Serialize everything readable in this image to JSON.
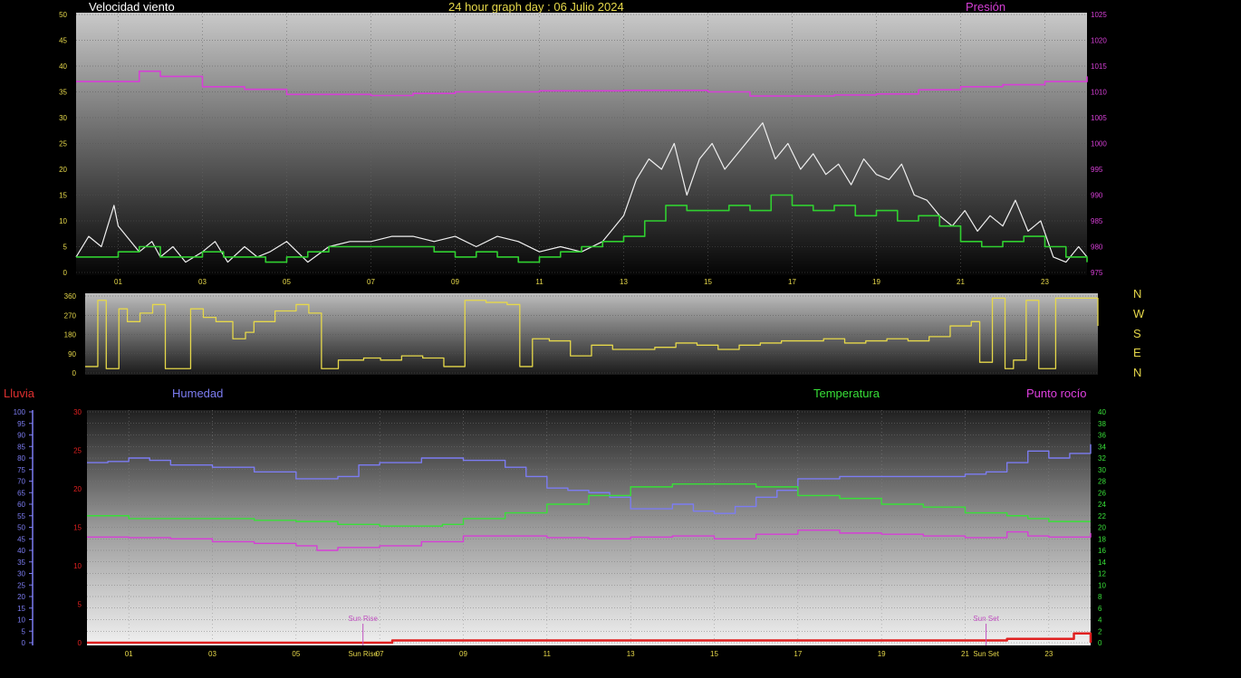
{
  "titles": {
    "main": "24 hour graph day : 06 Julio 2024",
    "wind": "Velocidad viento",
    "pressure": "Presión",
    "rain": "Lluvia",
    "humidity": "Humedad",
    "temperature": "Temperatura",
    "dewpoint": "Punto rocío"
  },
  "directions": [
    "N",
    "W",
    "S",
    "E",
    "N"
  ],
  "colors": {
    "wind_gust": "#f0f0f0",
    "wind_avg": "#30d030",
    "pressure": "#d63fd6",
    "direction": "#e6d84a",
    "humidity": "#7c7cf2",
    "temperature": "#38e038",
    "dewpoint": "#d63fd6",
    "rain": "#e02020",
    "sun": "#c050c0"
  },
  "chart_data": [
    {
      "type": "line",
      "name": "wind-pressure",
      "x_ticks": [
        "01",
        "03",
        "05",
        "07",
        "09",
        "11",
        "13",
        "15",
        "17",
        "19",
        "21",
        "23"
      ],
      "y_left_ticks": [
        "0",
        "5",
        "10",
        "15",
        "20",
        "25",
        "30",
        "35",
        "40",
        "45",
        "50"
      ],
      "y_right_ticks": [
        "975",
        "980",
        "985",
        "990",
        "995",
        "1000",
        "1005",
        "1010",
        "1015",
        "1020",
        "1025"
      ],
      "ylim_left": [
        0,
        50
      ],
      "ylim_right": [
        975,
        1025
      ],
      "xlim": [
        0,
        24
      ],
      "series": [
        {
          "name": "Velocidad viento",
          "axis": "left",
          "kind": "gust",
          "x": [
            0,
            0.3,
            0.6,
            0.9,
            1.0,
            1.2,
            1.5,
            1.8,
            2.0,
            2.3,
            2.6,
            3.0,
            3.3,
            3.6,
            4.0,
            4.3,
            4.6,
            5.0,
            5.5,
            6.0,
            6.5,
            7.0,
            7.5,
            8.0,
            8.5,
            9.0,
            9.5,
            10.0,
            10.5,
            11.0,
            11.5,
            12.0,
            12.5,
            13.0,
            13.3,
            13.6,
            13.9,
            14.2,
            14.5,
            14.8,
            15.1,
            15.4,
            15.7,
            16.0,
            16.3,
            16.6,
            16.9,
            17.2,
            17.5,
            17.8,
            18.1,
            18.4,
            18.7,
            19.0,
            19.3,
            19.6,
            19.9,
            20.2,
            20.5,
            20.8,
            21.1,
            21.4,
            21.7,
            22.0,
            22.3,
            22.6,
            22.9,
            23.2,
            23.5,
            23.8,
            24.0
          ],
          "y": [
            3,
            7,
            5,
            13,
            9,
            7,
            4,
            6,
            3,
            5,
            2,
            4,
            6,
            2,
            5,
            3,
            4,
            6,
            2,
            5,
            6,
            6,
            7,
            7,
            6,
            7,
            5,
            7,
            6,
            4,
            5,
            4,
            6,
            11,
            18,
            22,
            20,
            25,
            15,
            22,
            25,
            20,
            23,
            26,
            29,
            22,
            25,
            20,
            23,
            19,
            21,
            17,
            22,
            19,
            18,
            21,
            15,
            14,
            11,
            9,
            12,
            8,
            11,
            9,
            14,
            8,
            10,
            3,
            2,
            5,
            3
          ]
        },
        {
          "name": "Velocidad viento",
          "axis": "left",
          "kind": "avg",
          "x": [
            0,
            0.5,
            1.0,
            1.5,
            2.0,
            2.5,
            3.0,
            3.5,
            4.0,
            4.5,
            5.0,
            5.5,
            6.0,
            6.5,
            7.0,
            7.5,
            8.0,
            8.5,
            9.0,
            9.5,
            10.0,
            10.5,
            11.0,
            11.5,
            12.0,
            12.5,
            13.0,
            13.5,
            14.0,
            14.5,
            15.0,
            15.5,
            16.0,
            16.5,
            17.0,
            17.5,
            18.0,
            18.5,
            19.0,
            19.5,
            20.0,
            20.5,
            21.0,
            21.5,
            22.0,
            22.5,
            23.0,
            23.5,
            24.0
          ],
          "y": [
            3,
            3,
            4,
            5,
            3,
            3,
            4,
            3,
            3,
            2,
            3,
            4,
            5,
            5,
            5,
            5,
            5,
            4,
            3,
            4,
            3,
            2,
            3,
            4,
            5,
            6,
            7,
            10,
            13,
            12,
            12,
            13,
            12,
            15,
            13,
            12,
            13,
            11,
            12,
            10,
            11,
            9,
            6,
            5,
            6,
            7,
            5,
            3,
            2
          ]
        },
        {
          "name": "Presión",
          "axis": "right",
          "x": [
            0,
            1.0,
            1.5,
            2.0,
            3.0,
            4.0,
            5.0,
            6.0,
            7.0,
            8.0,
            9.0,
            10.0,
            11.0,
            12.0,
            13.0,
            14.0,
            15.0,
            16.0,
            17.0,
            18.0,
            19.0,
            20.0,
            21.0,
            22.0,
            23.0,
            24.0
          ],
          "y": [
            1012,
            1012,
            1014,
            1013,
            1011,
            1010.5,
            1009.5,
            1009.5,
            1009.3,
            1009.7,
            1010,
            1010,
            1010.2,
            1010.2,
            1010.3,
            1010.3,
            1010,
            1009.2,
            1009.2,
            1009.4,
            1009.6,
            1010.4,
            1011,
            1011.4,
            1012,
            1013
          ]
        }
      ]
    },
    {
      "type": "line",
      "name": "wind-direction",
      "y_ticks": [
        "0",
        "90",
        "180",
        "270",
        "360"
      ],
      "ylim": [
        0,
        360
      ],
      "xlim": [
        0,
        24
      ],
      "series": [
        {
          "name": "direction",
          "x": [
            0,
            0.3,
            0.5,
            0.8,
            1.0,
            1.3,
            1.6,
            1.9,
            2.2,
            2.5,
            2.8,
            3.1,
            3.5,
            3.8,
            4.0,
            4.5,
            5.0,
            5.3,
            5.6,
            6.0,
            6.3,
            6.6,
            7.0,
            7.5,
            8.0,
            8.5,
            9.0,
            9.5,
            10.0,
            10.3,
            10.6,
            11.0,
            11.5,
            12.0,
            12.5,
            13.0,
            13.5,
            14.0,
            14.5,
            15.0,
            15.5,
            16.0,
            16.5,
            17.0,
            17.5,
            18.0,
            18.5,
            19.0,
            19.5,
            20.0,
            20.5,
            21.0,
            21.2,
            21.5,
            21.8,
            22.0,
            22.3,
            22.6,
            23.0,
            23.5,
            24.0
          ],
          "y": [
            30,
            340,
            20,
            300,
            240,
            280,
            320,
            20,
            20,
            300,
            260,
            240,
            160,
            190,
            240,
            290,
            320,
            280,
            20,
            60,
            60,
            70,
            60,
            80,
            70,
            30,
            340,
            330,
            320,
            30,
            160,
            150,
            80,
            130,
            110,
            110,
            120,
            140,
            130,
            110,
            130,
            140,
            150,
            150,
            160,
            140,
            150,
            160,
            150,
            170,
            220,
            240,
            50,
            350,
            20,
            60,
            340,
            20,
            350,
            350,
            220
          ]
        }
      ]
    },
    {
      "type": "line",
      "name": "temp-humidity-rain",
      "x_ticks": [
        "01",
        "03",
        "05",
        "07",
        "09",
        "11",
        "13",
        "15",
        "17",
        "19",
        "21",
        "23"
      ],
      "y_rain_ticks": [
        "0",
        "5",
        "10",
        "15",
        "20",
        "25",
        "30"
      ],
      "y_hum_ticks": [
        "0",
        "5",
        "10",
        "15",
        "20",
        "25",
        "30",
        "35",
        "40",
        "45",
        "50",
        "55",
        "60",
        "65",
        "70",
        "75",
        "80",
        "85",
        "90",
        "95",
        "100"
      ],
      "y_temp_ticks": [
        "0",
        "2",
        "4",
        "6",
        "8",
        "10",
        "12",
        "14",
        "16",
        "18",
        "20",
        "22",
        "24",
        "26",
        "28",
        "30",
        "32",
        "34",
        "36",
        "38",
        "40"
      ],
      "ylim_rain": [
        0,
        30
      ],
      "ylim_hum": [
        0,
        100
      ],
      "ylim_temp": [
        0,
        40
      ],
      "xlim": [
        0,
        24
      ],
      "annotations": [
        {
          "text": "Sun Rise",
          "x": 6.6
        },
        {
          "text": "Sun Set",
          "x": 21.5
        }
      ],
      "bottom_labels": [
        "Sun Rise",
        "Sun Set"
      ],
      "series": [
        {
          "name": "Humedad",
          "axis": "hum",
          "x": [
            0,
            0.5,
            1.0,
            1.5,
            2.0,
            3.0,
            4.0,
            5.0,
            5.5,
            6.0,
            6.5,
            7.0,
            8.0,
            9.0,
            9.5,
            10.0,
            10.5,
            11.0,
            11.5,
            12.0,
            12.5,
            13.0,
            13.5,
            14.0,
            14.5,
            15.0,
            15.5,
            16.0,
            16.5,
            17.0,
            18.0,
            19.0,
            20.0,
            21.0,
            21.5,
            22.0,
            22.5,
            23.0,
            23.5,
            24.0
          ],
          "y": [
            78,
            78.5,
            80,
            79,
            77,
            76,
            74,
            71,
            71,
            72,
            77,
            78,
            80,
            79,
            79,
            76,
            72,
            67,
            66,
            65,
            63,
            58,
            58,
            60,
            57,
            56,
            59,
            63,
            66,
            71,
            72,
            72,
            72,
            73,
            74,
            78,
            83,
            80,
            82,
            86
          ]
        },
        {
          "name": "Temperatura",
          "axis": "temp",
          "x": [
            0,
            1.0,
            2.0,
            3.0,
            4.0,
            5.0,
            6.0,
            7.0,
            8.0,
            8.5,
            9.0,
            10.0,
            11.0,
            12.0,
            13.0,
            14.0,
            15.0,
            16.0,
            17.0,
            18.0,
            19.0,
            20.0,
            21.0,
            22.0,
            22.5,
            23.0,
            24.0
          ],
          "y": [
            22,
            21.5,
            21.5,
            21.5,
            21.2,
            21,
            20.5,
            20.2,
            20.2,
            20.5,
            21.5,
            22.5,
            24,
            25.5,
            27,
            27.5,
            27.5,
            27,
            25.5,
            25,
            24,
            23.5,
            22.5,
            22,
            21.5,
            21,
            21
          ]
        },
        {
          "name": "Punto rocío",
          "axis": "temp",
          "x": [
            0,
            1.0,
            2.0,
            3.0,
            4.0,
            5.0,
            5.5,
            6.0,
            7.0,
            8.0,
            9.0,
            10.0,
            11.0,
            12.0,
            13.0,
            14.0,
            15.0,
            16.0,
            17.0,
            18.0,
            19.0,
            20.0,
            21.0,
            22.0,
            22.5,
            23.0,
            24.0
          ],
          "y": [
            18.3,
            18.2,
            18,
            17.5,
            17.2,
            16.8,
            16,
            16.5,
            16.8,
            17.5,
            18.5,
            18.5,
            18.2,
            18,
            18.3,
            18.5,
            18,
            18.8,
            19.5,
            19,
            18.8,
            18.5,
            18.2,
            19.2,
            18.5,
            18.3,
            19
          ]
        },
        {
          "name": "Lluvia",
          "axis": "rain",
          "x": [
            0,
            7.2,
            7.3,
            21.8,
            22.0,
            23.5,
            23.6,
            23.8,
            24.0
          ],
          "y": [
            0,
            0,
            0.3,
            0.3,
            0.5,
            0.5,
            1.2,
            1.2,
            0
          ]
        }
      ]
    }
  ]
}
